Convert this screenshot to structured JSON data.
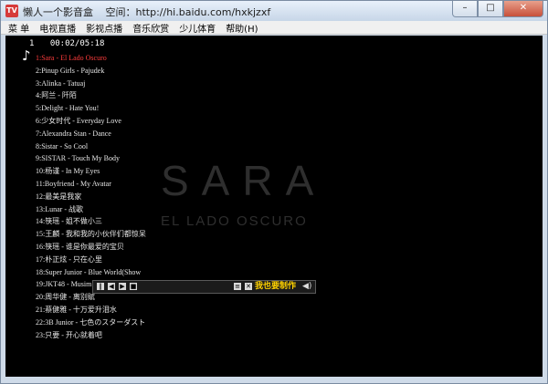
{
  "window": {
    "app_icon_text": "TV",
    "title": "懒人一个影音盒",
    "space_label": "空间：http://hi.baidu.com/hxkjzxf",
    "min_glyph": "–",
    "max_glyph": "□",
    "close_glyph": "✕"
  },
  "menu": [
    "菜 单",
    "电视直播",
    "影视点播",
    "音乐欣赏",
    "少儿体育",
    "帮助(H)"
  ],
  "player": {
    "index": "1",
    "time": "00:02/05:18",
    "now_playing_title": "SARA",
    "now_playing_subtitle": "EL LADO OSCURO",
    "make_label": "我也要制作",
    "volume_glyph": "◀)"
  },
  "playlist": [
    "1:Sara - El Lado Oscuro",
    "2:Pinup Girls - Pajudek",
    "3:Alinka - Tatuaj",
    "4:阿兰 - 阡陌",
    "5:Delight - Hate You!",
    "6:少女时代 - Everyday Love",
    "7:Alexandra Stan - Dance",
    "8:Sistar - So Cool",
    "9:SISTAR - Touch My Body",
    "10:杨谨 - In My Eyes",
    "11:Boyfriend - My Avatar",
    "12:最美是我家",
    "13:Lunar - 战歌",
    "14:筷瑶 - 姐不做小三",
    "15:王麟 - 我和我的小伙伴们都惊呆",
    "16:筷瑶 - 谁是你最爱的宝贝",
    "17:朴正炫 - 只在心里",
    "18:Super Junior - Blue World(Show",
    "19:JKT48 - Musim Yang Ditunggu",
    "20:周华健 - 离别赋",
    "21:蔡健雅 - 十万爱升泪水",
    "22:3B Junior - 七色のスターダスト",
    "23:只要 - 开心就着吧"
  ]
}
